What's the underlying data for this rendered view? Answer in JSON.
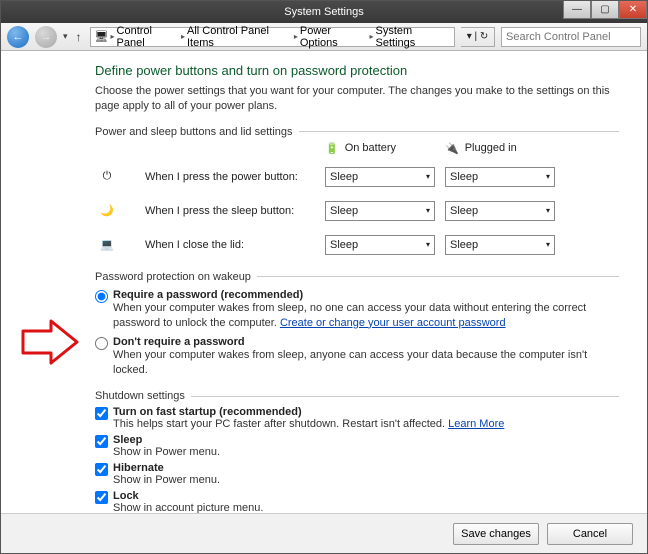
{
  "title": "System Settings",
  "breadcrumb": {
    "icon": "pc",
    "items": [
      "Control Panel",
      "All Control Panel Items",
      "Power Options",
      "System Settings"
    ]
  },
  "search": {
    "placeholder": "Search Control Panel"
  },
  "heading": "Define power buttons and turn on password protection",
  "description": "Choose the power settings that you want for your computer. The changes you make to the settings on this page apply to all of your power plans.",
  "section1": {
    "title": "Power and sleep buttons and lid settings",
    "col_battery": "On battery",
    "col_plugged": "Plugged in",
    "rows": [
      {
        "label": "When I press the power button:",
        "battery": "Sleep",
        "plugged": "Sleep"
      },
      {
        "label": "When I press the sleep button:",
        "battery": "Sleep",
        "plugged": "Sleep"
      },
      {
        "label": "When I close the lid:",
        "battery": "Sleep",
        "plugged": "Sleep"
      }
    ]
  },
  "section2": {
    "title": "Password protection on wakeup",
    "require": {
      "label": "Require a password (recommended)",
      "sub1": "When your computer wakes from sleep, no one can access your data without entering the correct password to unlock the computer. ",
      "link": "Create or change your user account password"
    },
    "dont": {
      "label": "Don't require a password",
      "sub": "When your computer wakes from sleep, anyone can access your data because the computer isn't locked."
    }
  },
  "section3": {
    "title": "Shutdown settings",
    "fast": {
      "label": "Turn on fast startup (recommended)",
      "sub": "This helps start your PC faster after shutdown. Restart isn't affected. ",
      "link": "Learn More"
    },
    "sleep": {
      "label": "Sleep",
      "sub": "Show in Power menu."
    },
    "hibernate": {
      "label": "Hibernate",
      "sub": "Show in Power menu."
    },
    "lock": {
      "label": "Lock",
      "sub": "Show in account picture menu."
    }
  },
  "footer": {
    "save": "Save changes",
    "cancel": "Cancel"
  }
}
